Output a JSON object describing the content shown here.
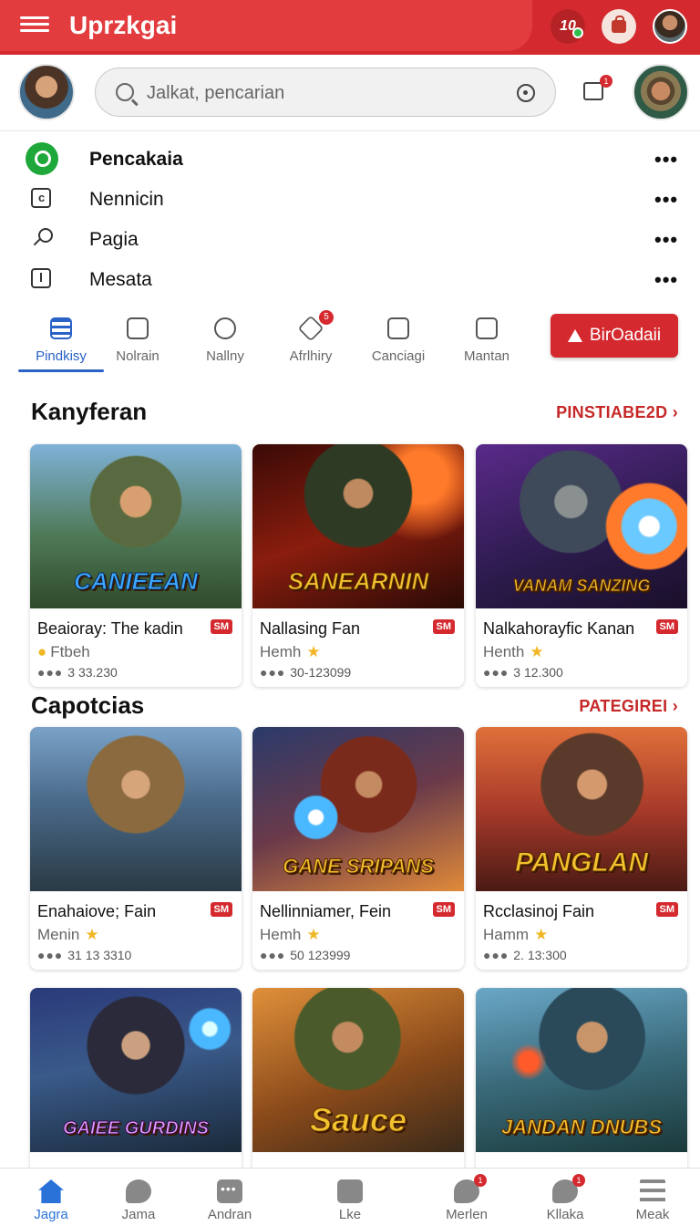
{
  "header": {
    "app_title": "Uprzkgai",
    "games_icon_text": "10"
  },
  "search": {
    "placeholder": "Jalkat, pencarian"
  },
  "menu": [
    {
      "label": "Pencakaia",
      "icon": "green-search-icon",
      "more": "•••"
    },
    {
      "label": "Nennicin",
      "icon": "square-c-icon",
      "more": "•••"
    },
    {
      "label": "Pagia",
      "icon": "microphone-icon",
      "more": "•••"
    },
    {
      "label": "Mesata",
      "icon": "timer-icon",
      "more": "•••"
    }
  ],
  "tabs": [
    {
      "label": "Pindkisy",
      "icon": "list-icon",
      "active": true
    },
    {
      "label": "Nolrain",
      "icon": "calendar-icon"
    },
    {
      "label": "Nallny",
      "icon": "check-circle-icon"
    },
    {
      "label": "Afrlhiry",
      "icon": "tag-icon",
      "badge": "5"
    },
    {
      "label": "Canciagi",
      "icon": "box-icon"
    },
    {
      "label": "Mantan",
      "icon": "grid-icon"
    }
  ],
  "cta": {
    "label": "BirOadaii",
    "icon": "warning-icon"
  },
  "sections": [
    {
      "title": "Kanyferan",
      "link": "PINSTIABE2D",
      "cards": [
        {
          "art_title": "CANIEEAN",
          "name": "Beaioray: The kadin",
          "tag": "SM",
          "sub": "Ftbeh",
          "stats": "3 33.230"
        },
        {
          "art_title": "SANEARNIN",
          "name": "Nallasing Fan",
          "tag": "SM",
          "sub": "Hemh",
          "stats": "30-123099"
        },
        {
          "art_title": "VANAM SANZING",
          "name": "Nalkahorayfic Kanan",
          "tag": "SM",
          "sub": "Henth",
          "stats": "3 12.300"
        }
      ]
    },
    {
      "title": "Capotcias",
      "link": "PATEGIREI",
      "cards": [
        {
          "art_title": "",
          "name": "Enahaiove; Fain",
          "tag": "SM",
          "sub": "Menin",
          "stats": "31 13 3310"
        },
        {
          "art_title": "GANE SRIPANS",
          "name": "Nellinniamer, Fein",
          "tag": "SM",
          "sub": "Hemh",
          "stats": "50 123999"
        },
        {
          "art_title": "PANGLAN",
          "name": "Rcclasinoj Fain",
          "tag": "SM",
          "sub": "Hamm",
          "stats": "2. 13:300"
        }
      ]
    },
    {
      "cards": [
        {
          "art_title": "GAIEE GURDINS"
        },
        {
          "art_title": "Sauce"
        },
        {
          "art_title": "JANDAN DNUBS"
        }
      ]
    }
  ],
  "bottom_nav": [
    {
      "label": "Jagra",
      "icon": "home-icon",
      "active": true
    },
    {
      "label": "Jama",
      "icon": "microphone-icon"
    },
    {
      "label": "Andran",
      "icon": "chat-icon"
    },
    {
      "label": "Lke",
      "icon": "edit-icon"
    },
    {
      "label": "Merlen",
      "icon": "notification-icon",
      "badge": "1"
    },
    {
      "label": "Kllaka",
      "icon": "mic-icon",
      "badge": "1"
    },
    {
      "label": "Meak",
      "icon": "menu-icon"
    }
  ],
  "colors": {
    "brand_red": "#d42a2f",
    "active_blue": "#2a62c7",
    "star": "#f1b625"
  }
}
